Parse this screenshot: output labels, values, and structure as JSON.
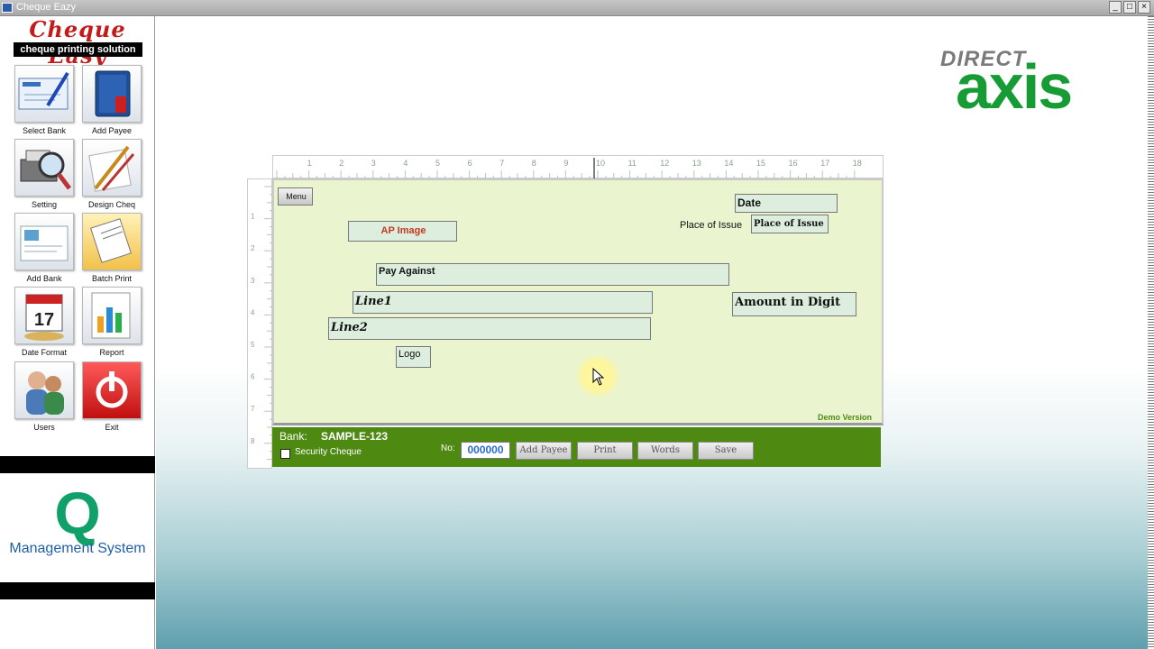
{
  "window": {
    "title": "Cheque Eazy",
    "buttons": [
      "_",
      "□",
      "×"
    ]
  },
  "sidebar": {
    "logo_title": "Cheque Easy",
    "logo_subtitle": "cheque printing solution",
    "tools": [
      {
        "label": "Select Bank",
        "icon": "cheque-pen-icon"
      },
      {
        "label": "Add Payee",
        "icon": "address-book-icon"
      },
      {
        "label": "Setting",
        "icon": "printer-magnifier-icon"
      },
      {
        "label": "Design Cheq",
        "icon": "design-tools-icon"
      },
      {
        "label": "Add Bank",
        "icon": "bank-document-icon"
      },
      {
        "label": "Batch Print",
        "icon": "batch-documents-icon"
      },
      {
        "label": "Date Format",
        "icon": "calendar-icon"
      },
      {
        "label": "Report",
        "icon": "report-chart-icon"
      },
      {
        "label": "Users",
        "icon": "users-icon"
      },
      {
        "label": "Exit",
        "icon": "power-icon"
      }
    ],
    "q_logo": "Q",
    "q_text": "Management System"
  },
  "branding": {
    "direct": "DIRECT",
    "axis": "axis"
  },
  "ruler": {
    "top_numbers": [
      "1",
      "2",
      "3",
      "4",
      "5",
      "6",
      "7",
      "8",
      "9",
      "10",
      "11",
      "12",
      "13",
      "14",
      "15",
      "16",
      "17",
      "18"
    ],
    "left_numbers": [
      "1",
      "2",
      "3",
      "4",
      "5",
      "6",
      "7",
      "8"
    ]
  },
  "cheque": {
    "menu_button": "Menu",
    "date": "Date",
    "place_of_issue_label": "Place of Issue",
    "place_of_issue_field": "Place of Issue",
    "ap_image": "AP Image",
    "pay_against": "Pay Against",
    "line1": "Line1",
    "line2": "Line2",
    "amount_digit": "Amount in Digit",
    "logo": "Logo",
    "demo_version": "Demo Version"
  },
  "bottom_bar": {
    "bank_label": "Bank:",
    "bank_value": "SAMPLE-123",
    "security_cheque": "Security Cheque",
    "security_checked": false,
    "no_label": "No:",
    "no_value": "000000",
    "buttons": {
      "add_payee": "Add Payee",
      "print": "Print",
      "words": "Words",
      "save": "Save"
    }
  }
}
